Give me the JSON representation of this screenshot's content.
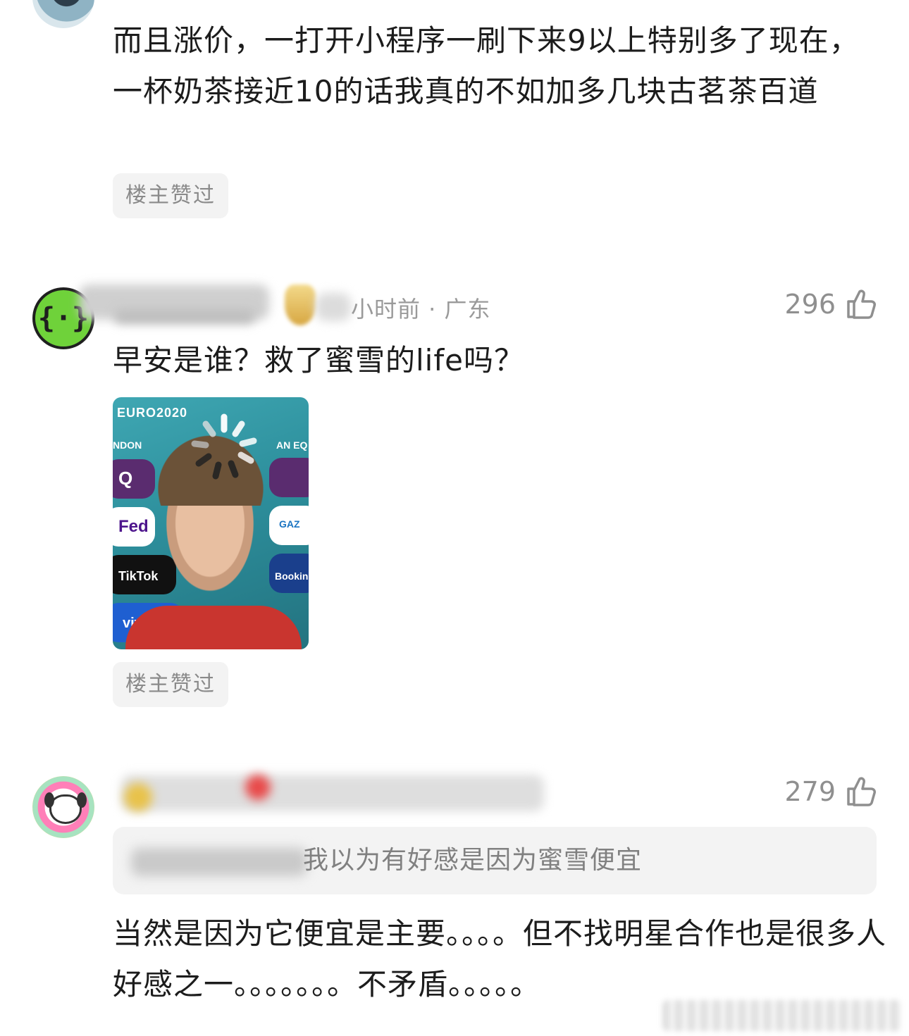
{
  "comments": [
    {
      "text": "而且涨价，一打开小程序一刷下来9以上特别多了现在，一杯奶茶接近10的话我真的不如加多几块古茗茶百道",
      "badge": "楼主赞过"
    },
    {
      "avatar_glyph": "{·}",
      "meta_time": "小时前 · 广东",
      "likes": "296",
      "text": "早安是谁？救了蜜雪的life吗？",
      "image_text": {
        "event": "EURO2020",
        "board_left_1": "NDON",
        "board_right_1": "AN EQ",
        "sponsor_1": "Q",
        "sponsor_2": "Fed",
        "sponsor_3": "TikTok",
        "sponsor_4": "vivo",
        "sponsor_5": "Booking",
        "sponsor_6": "GAZ"
      },
      "badge": "楼主赞过"
    },
    {
      "likes": "279",
      "quote_text": "我以为有好感是因为蜜雪便宜",
      "text": "当然是因为它便宜是主要。。。。但不找明星合作也是很多人好感之一。。。。。。。不矛盾。。。。。"
    }
  ],
  "icons": {
    "like": "thumbs-up-icon",
    "spinner": "loading-spinner-icon"
  },
  "colors": {
    "text": "#1c1c1c",
    "meta": "#9a9a9a",
    "badge_bg": "#f3f3f3",
    "badge_text": "#8a8a8a",
    "avatar_green": "#6fd23a"
  }
}
